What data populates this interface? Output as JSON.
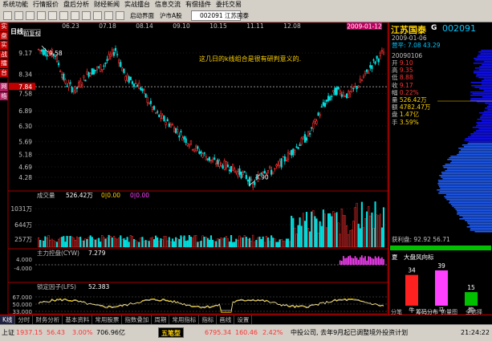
{
  "menu": [
    "系统功能",
    "行情报价",
    "盘后分析",
    "财经新闻",
    "实战擂台",
    "信息交流",
    "有偿插件",
    "委托交易"
  ],
  "toolbar": {
    "launch_label": "启动界面",
    "market_label": "沪市A股",
    "stock_field": "002091  江苏国泰"
  },
  "left_tabs": [
    "实",
    "盘",
    "实",
    "战",
    "擂",
    "台"
  ],
  "left_tabs_lower": [
    "网",
    "络"
  ],
  "chart": {
    "period_label": "日线",
    "rights_label": "前复权",
    "date_ticks": [
      "06.23",
      "07.18",
      "08.14",
      "09.10",
      "10.15",
      "11.11",
      "12.08"
    ],
    "cursor_date": "2009-01-12",
    "price_ticks": [
      "9.17",
      "8.34",
      "7.84",
      "7.58",
      "6.89",
      "6.30",
      "5.69",
      "5.18",
      "4.69",
      "4.28"
    ],
    "high_label": "9.58",
    "low_label": "3.90",
    "annotation": "这几日的k线组合是很有研判意义的.",
    "volume_title": "成交量",
    "volume_value": "526.42万",
    "volume_ma1": "0|0.00",
    "volume_ma2": "0|0.00",
    "volume_ticks": [
      "1031万",
      "644万",
      "257万"
    ],
    "volume_unit": "万",
    "cyw_title": "主力控盘(CYW)",
    "cyw_value": "7.279",
    "cyw_ticks": [
      "4.000",
      "-4.000"
    ],
    "lfs_title": "锁定因子(LFS)",
    "lfs_value": "52.383",
    "lfs_ticks": [
      "67.000",
      "50.000",
      "33.000"
    ]
  },
  "chart_data": {
    "type": "line",
    "title": "002091 江苏国泰 日线",
    "x": [
      "06.23",
      "07.18",
      "08.14",
      "09.10",
      "10.15",
      "11.11",
      "12.08",
      "2009-01-12"
    ],
    "series": [
      {
        "name": "收盘",
        "values": [
          9.17,
          8.1,
          8.8,
          6.4,
          4.6,
          4.5,
          7.8,
          8.9
        ]
      }
    ],
    "ylim": [
      3.9,
      9.58
    ]
  },
  "side": {
    "name": "江苏国泰",
    "badge": "G",
    "code": "002091",
    "date": "2009-01-06",
    "cap_line": "营平: 7.08 43.29",
    "date2": "20090106",
    "rows": [
      {
        "k": "开",
        "v": "9.10",
        "c": "red"
      },
      {
        "k": "高",
        "v": "9.35",
        "c": "red"
      },
      {
        "k": "低",
        "v": "8.88",
        "c": "red"
      },
      {
        "k": "收",
        "v": "9.17",
        "c": "red"
      },
      {
        "k": "幅",
        "v": "0.22%",
        "c": "red"
      },
      {
        "k": "量",
        "v": "526.42万",
        "c": "yellow"
      },
      {
        "k": "额",
        "v": "4782.47万",
        "c": "yellow"
      },
      {
        "k": "盘",
        "v": "1.47亿",
        "c": "yellow"
      },
      {
        "k": "手",
        "v": "3.59%",
        "c": "yellow"
      }
    ],
    "profit_label": "获利盘:",
    "profit_value": "92.92 56.71",
    "wind_label": "大盘风向标",
    "wind_prefix": "夏",
    "bars": [
      {
        "label": "牛",
        "value": "34",
        "color": "#ff2020"
      },
      {
        "label": "马",
        "value": "39",
        "color": "#ff40ff"
      },
      {
        "label": "熊",
        "value": "15",
        "color": "#00c000"
      }
    ],
    "tabs": [
      "分笔",
      "筹码分布",
      "价量图",
      "全选择"
    ]
  },
  "bottom_tabs": [
    "K线",
    "分时",
    "财务分析",
    "基本资料",
    "常用股票",
    "指数叠加",
    "周期",
    "常用指标",
    "指标",
    "画线",
    "设置"
  ],
  "status": {
    "sh_label": "上证",
    "sh_value": "1937.15",
    "sh_change": "56.43",
    "sh_pct": "3.00%",
    "sh_amount": "706.96亿",
    "wuxing": "五笔型",
    "sz_value": "6795.34",
    "sz_change": "160.46",
    "sz_pct": "2.42%",
    "ticker": "中投公司,  去年9月起已调整境外投资计划",
    "time": "21:24:22"
  }
}
